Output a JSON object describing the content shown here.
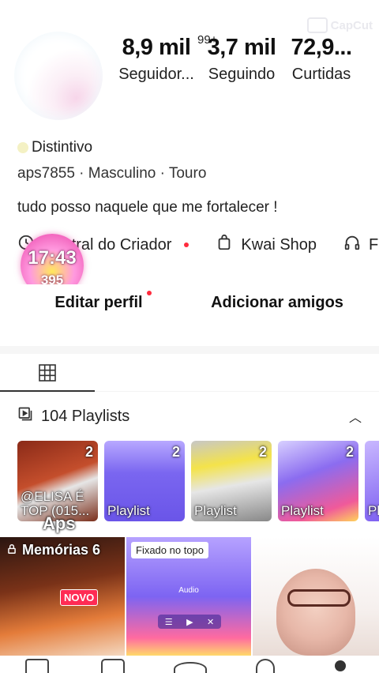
{
  "watermark": {
    "text": "CapCut"
  },
  "profile": {
    "stats": [
      {
        "value": "8,9 mil",
        "label": "Seguidor..."
      },
      {
        "value": "3,7 mil",
        "label": "Seguindo"
      },
      {
        "value": "72,9...",
        "label": "Curtidas"
      }
    ],
    "stat_badge": "99+",
    "badge_label": "Distintivo",
    "meta": "aps7855 · Masculino · Touro",
    "bio": "tudo posso naquele que me fortalecer !"
  },
  "actions": {
    "creator": "Central do Criador",
    "shop": "Kwai Shop",
    "music_partial": "F"
  },
  "timer": {
    "time": "17:43",
    "coins": "395"
  },
  "buttons": {
    "edit": "Editar perfil",
    "add_friends": "Adicionar amigos"
  },
  "playlists": {
    "header": "104 Playlists",
    "items": [
      {
        "count": "2",
        "title": "@ELISA É TOP (015..."
      },
      {
        "count": "2",
        "title": "Playlist"
      },
      {
        "count": "2",
        "title": "Playlist"
      },
      {
        "count": "2",
        "title": "Playlist"
      },
      {
        "count": "",
        "title": "Pla"
      }
    ]
  },
  "aps_label": "Aps",
  "grid": {
    "memories": "Memórias 6",
    "novo": "NOVO",
    "pinned": "Fixado no topo",
    "audio": "Audio"
  },
  "colors": {
    "accent": "#ff2b3d",
    "text": "#161616"
  }
}
